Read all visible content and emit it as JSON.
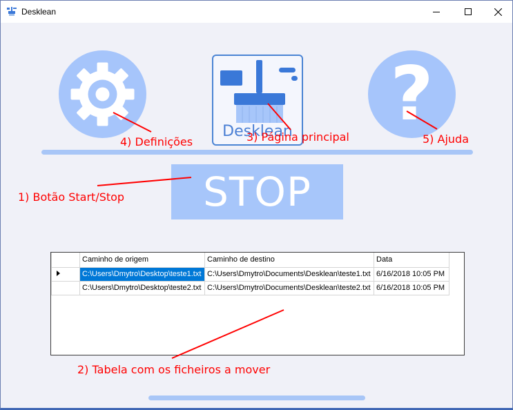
{
  "window": {
    "title": "Desklean",
    "controls": {
      "minimize_icon": "minimize-icon",
      "maximize_icon": "maximize-icon",
      "close_icon": "close-icon"
    }
  },
  "toolbar": {
    "settings_icon": "gear-icon",
    "main_logo_text": "Desklean",
    "main_icon": "broom-icon",
    "help_icon": "question-mark-icon",
    "help_glyph": "?"
  },
  "start_stop_button": {
    "label": "STOP"
  },
  "file_table": {
    "columns": [
      "Caminho de origem",
      "Caminho de destino",
      "Data"
    ],
    "rows": [
      {
        "origem": "C:\\Users\\Dmytro\\Desktop\\teste1.txt",
        "destino": "C:\\Users\\Dmytro\\Documents\\Desklean\\teste1.txt",
        "data": "6/16/2018 10:05 PM"
      },
      {
        "origem": "C:\\Users\\Dmytro\\Desktop\\teste2.txt",
        "destino": "C:\\Users\\Dmytro\\Documents\\Desklean\\teste2.txt",
        "data": "6/16/2018 10:05 PM"
      }
    ]
  },
  "annotations": {
    "start_stop": "1) Botão Start/Stop",
    "table": "2) Tabela com os ficheiros a mover",
    "main_page": "3) Página principal",
    "settings": "4) Definições",
    "help": "5) Ajuda"
  },
  "colors": {
    "accent_light": "#a7c6fa",
    "accent": "#4a84d4",
    "annotation": "#ff0000",
    "selection": "#0078d7"
  }
}
